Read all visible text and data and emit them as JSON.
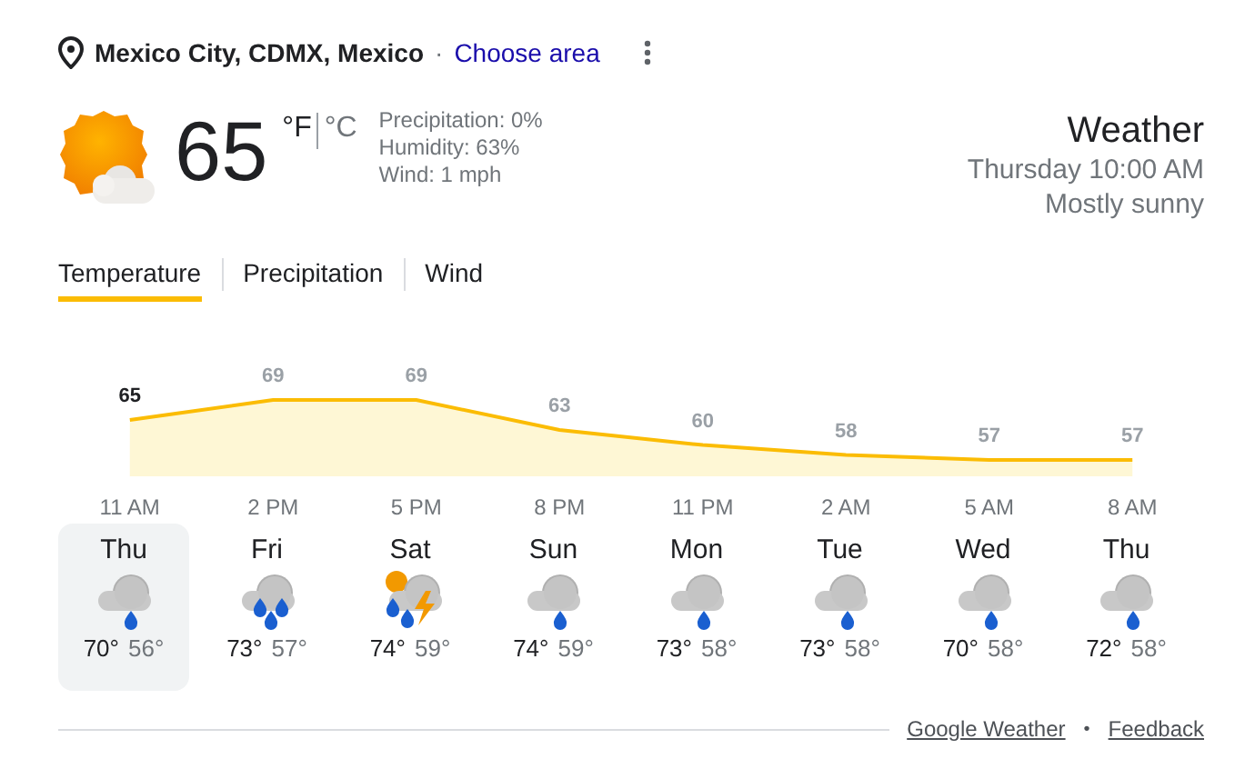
{
  "location": {
    "place": "Mexico City, CDMX, Mexico",
    "separator": "·",
    "link": "Choose area"
  },
  "current": {
    "kind": "sun_cloud",
    "temperature": "65",
    "units": [
      {
        "label": "°F",
        "selected": true
      },
      {
        "label": "°C",
        "selected": false
      }
    ],
    "details": [
      "Precipitation: 0%",
      "Humidity: 63%",
      "Wind: 1 mph"
    ]
  },
  "summary": {
    "title": "Weather",
    "time": "Thursday 10:00 AM",
    "condition": "Mostly sunny"
  },
  "tabs": [
    {
      "label": "Temperature",
      "selected": true
    },
    {
      "label": "Precipitation",
      "selected": false
    },
    {
      "label": "Wind",
      "selected": false
    }
  ],
  "chart_data": {
    "type": "area",
    "categories": [
      "11 AM",
      "2 PM",
      "5 PM",
      "8 PM",
      "11 PM",
      "2 AM",
      "5 AM",
      "8 AM"
    ],
    "series": [
      {
        "color": "#fbbc04",
        "values": [
          65,
          69,
          69,
          63,
          60,
          58,
          57,
          57
        ]
      }
    ],
    "data_labels": true
  },
  "days": [
    {
      "day": "Thu",
      "kind": "rain",
      "high": "70°",
      "low": "56°",
      "selected": true
    },
    {
      "day": "Fri",
      "kind": "heavy_rain",
      "high": "73°",
      "low": "57°",
      "selected": false
    },
    {
      "day": "Sat",
      "kind": "thunder",
      "high": "74°",
      "low": "59°",
      "selected": false
    },
    {
      "day": "Sun",
      "kind": "rain",
      "high": "74°",
      "low": "59°",
      "selected": false
    },
    {
      "day": "Mon",
      "kind": "rain",
      "high": "73°",
      "low": "58°",
      "selected": false
    },
    {
      "day": "Tue",
      "kind": "rain",
      "high": "73°",
      "low": "58°",
      "selected": false
    },
    {
      "day": "Wed",
      "kind": "rain",
      "high": "70°",
      "low": "58°",
      "selected": false
    },
    {
      "day": "Thu",
      "kind": "rain",
      "high": "72°",
      "low": "58°",
      "selected": false
    }
  ],
  "footer": {
    "links": [
      "Google Weather",
      "Feedback"
    ],
    "separator": "•"
  }
}
